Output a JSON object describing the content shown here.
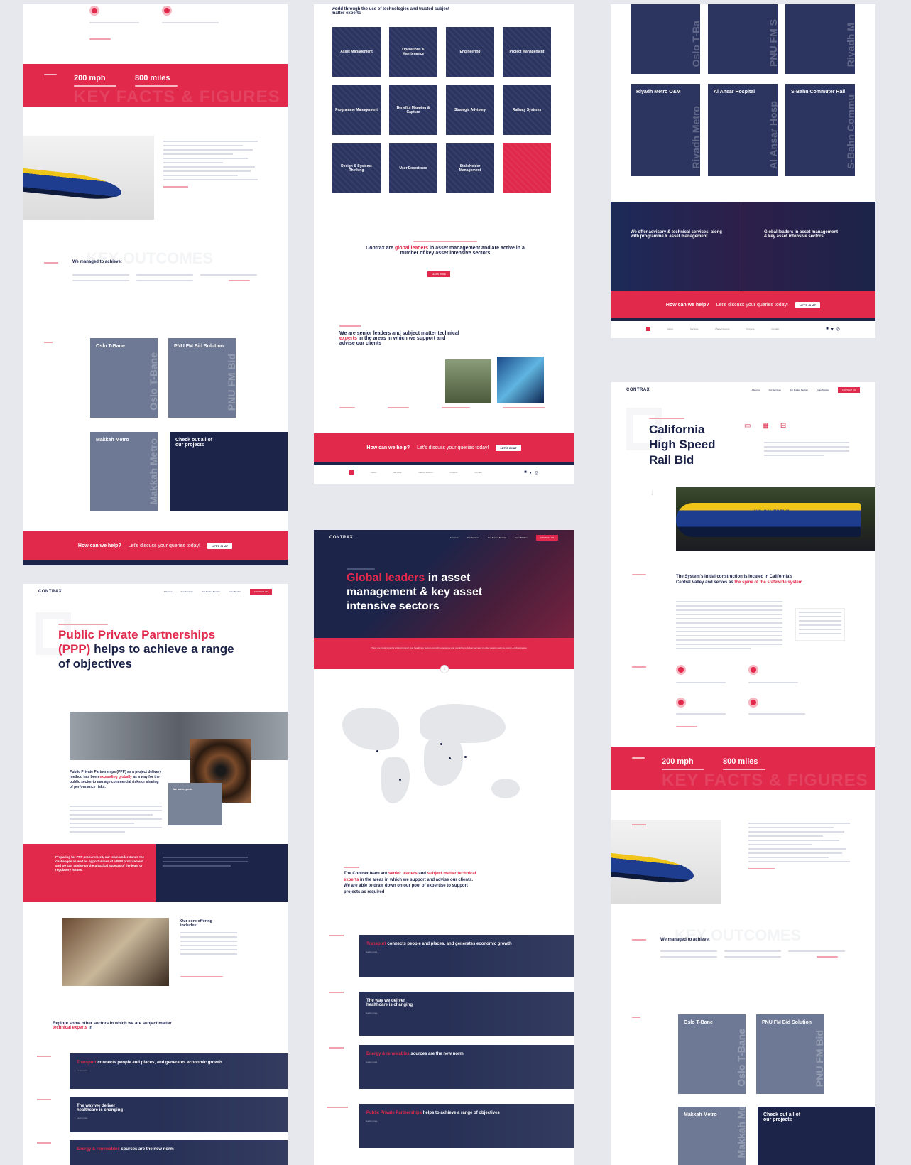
{
  "colors": {
    "accent": "#e0294b",
    "navy": "#1c2449",
    "bg": "#e6e8ee"
  },
  "common": {
    "cta_text": "How can we help?",
    "cta_sub": "Let's discuss your queries today!",
    "cta_button": "LET'S CHAT",
    "logo": "CONTRAX",
    "nav_links": [
      "About us",
      "Our Services",
      "Our Market Sectors",
      "Case Studies"
    ],
    "nav_button": "CONTACT US",
    "social_icons": [
      "linkedin-icon",
      "twitter-icon",
      "instagram-icon"
    ],
    "learn_more": "Learn more"
  },
  "panel1": {
    "stats": [
      {
        "value": "200 mph"
      },
      {
        "value": "800 miles"
      }
    ],
    "ghost": "KEY FACTS & FIGURES",
    "achieve_title": "We managed to achieve:",
    "projects": [
      {
        "name": "Oslo T-Bane",
        "vert": "Oslo T-Bane"
      },
      {
        "name": "PNU FM Bid Solution",
        "vert": "PNU FM Bid"
      },
      {
        "name": "Makkah Metro",
        "vert": "Makkah Metro"
      },
      {
        "name": "Check out all of our projects",
        "vert": ""
      }
    ]
  },
  "panel2": {
    "intro": "world through the use of technologies and trusted subject matter experts",
    "tiles": [
      "Asset Management",
      "Operations & Maintenance",
      "Engineering",
      "Project Management",
      "Programme Management",
      "Benefits Mapping & Capture",
      "Strategic Advisory",
      "Railway Systems",
      "Design & Systems Thinking",
      "User Experience",
      "Stakeholder Management",
      ""
    ],
    "statement_pre": "Contrax are ",
    "statement_red": "global leaders",
    "statement_post": " in asset management and are active in a number of key asset intensive sectors",
    "btn": "LEARN MORE",
    "experts_pre": "We are senior leaders and subject matter technical ",
    "experts_red": "experts",
    "experts_post": " in the areas in which we support and advise our clients"
  },
  "panel3": {
    "projects": [
      {
        "name": "Riyadh Metro O&M",
        "vert": "Riyadh Metro"
      },
      {
        "name": "Al Ansar Hospital",
        "vert": "Al Ansar Hosp"
      },
      {
        "name": "S-Bahn Commuter Rail",
        "vert": "S-Bahn Commu"
      }
    ],
    "top_verts": [
      "Oslo T-Ba",
      "PNU FM S",
      "Riyadh M"
    ],
    "left_text": "We offer advisory & technical services, along with programme & asset management",
    "right_text": "Global leaders in asset management & key asset intensive sectors"
  },
  "panel4": {
    "title_red": "Public Private Partnerships (PPP)",
    "title_rest": " helps to achieve a range of objectives",
    "para_pre": "Public Private Partnerships (PPP) as a project delivery method has been ",
    "para_red": "expanding globally",
    "para_post": " as a way for the public sector to manage commercial risks or sharing of performance risks.",
    "box_text": "We are experts",
    "red_block": "Preparing for PPP procurement, our team understands the challenges as well as opportunities of a PPP procurement and we can advise on the practical aspects of the legal or regulatory issues.",
    "core_title": "Our core offering includes:",
    "explore_pre": "Explore some other sectors in which we are subject matter ",
    "explore_red": "technical experts",
    "explore_post": " in",
    "sectors": [
      {
        "red": "Transport",
        "rest": " connects people and places, and generates economic growth"
      },
      {
        "red": "",
        "rest": "The way we deliver healthcare is changing"
      },
      {
        "red": "Energy & renewables",
        "rest": " sources are the new norm"
      }
    ]
  },
  "panel5": {
    "hero_red": "Global leaders",
    "hero_rest": " in asset management & key asset intensive sectors",
    "red_band": "These are predominantly within transport and healthcare sectors but with experience and capability to deliver services in other sectors such as energy & infrastructure",
    "team_pre": "The Contrax team are ",
    "team_red1": "senior leaders",
    "team_mid": " and ",
    "team_red2": "subject matter technical experts",
    "team_post": " in the areas in which we support and advise our clients. We are able to draw down on our pool of expertise to support projects as required",
    "sectors": [
      {
        "red": "Transport",
        "rest": " connects people and places, and generates economic growth"
      },
      {
        "red": "",
        "rest": "The way we deliver healthcare is changing"
      },
      {
        "red": "Energy & renewables",
        "rest": " sources are the new norm"
      },
      {
        "red": "Public Private Partnerships",
        "rest": " helps to achieve a range of objectives"
      }
    ]
  },
  "panel6": {
    "title": "California High Speed Rail Bid",
    "train_label": "U.S. CALIFORNIA",
    "system_pre": "The System's initial construction is located in California's Central Valley and serves as ",
    "system_red": "the spine of the statewide system",
    "stats": [
      {
        "value": "200 mph"
      },
      {
        "value": "800 miles"
      }
    ],
    "ghost": "KEY FACTS & FIGURES",
    "achieve_title": "We managed to achieve:",
    "projects": [
      {
        "name": "Oslo T-Bane",
        "vert": "Oslo T-Bane"
      },
      {
        "name": "PNU FM Bid Solution",
        "vert": "PNU FM Bid"
      },
      {
        "name": "Makkah Metro",
        "vert": "Makkah Metro"
      },
      {
        "name": "Check out all of our projects",
        "vert": ""
      }
    ]
  }
}
